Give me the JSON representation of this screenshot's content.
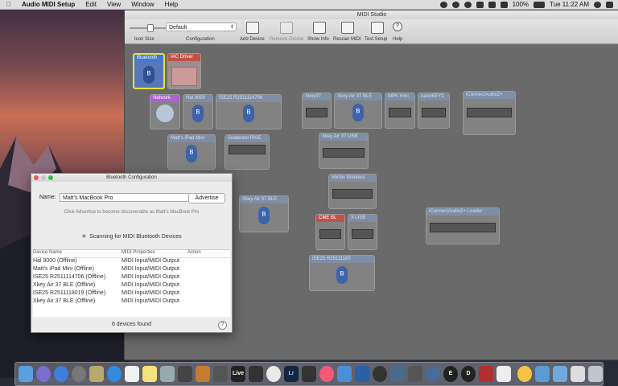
{
  "menubar": {
    "apple": "",
    "app_name": "Audio MIDI Setup",
    "menus": [
      "Edit",
      "View",
      "Window",
      "Help"
    ],
    "battery": "100%",
    "clock": "Tue 11:22 AM"
  },
  "studio": {
    "title": "MIDI Studio",
    "toolbar": {
      "icon_size_label": "Icon Size",
      "configuration_label": "Configuration",
      "configuration_value": "Default",
      "add_device": "Add Device",
      "remove_device": "Remove Device",
      "show_info": "Show Info",
      "rescan_midi": "Rescan MIDI",
      "test_setup": "Test Setup",
      "help": "Help",
      "help_glyph": "?"
    },
    "devices": {
      "bluetooth": "Bluetooth",
      "iac_driver": "IAC Driver",
      "network": "Network",
      "hal_9000": "Hal 9000",
      "ise25": "ISE25 R2511114706",
      "matts_ipad": "Matt's iPad Mini",
      "seaboard": "Seaboard RISE",
      "xkey37": "Xkey37",
      "xkey_air_37_ble_top": "Xkey Air 37 BLE",
      "mpk_mini": "MPK mini",
      "nano_q3": "nanoKEY2",
      "iconnect": "iConnectAudio2+",
      "xkey_air_37_usb": "Xkey Air 37 USB",
      "vortex": "Vortex Wireless",
      "xkey_air_37_ble": "Xkey Air 37 BLE",
      "cme_bl": "CME BL",
      "x_usb": "X-USB",
      "iconnect_loader": "iConnectAudio2+ Loader",
      "ise25_bottom": "ISE25 R25111180",
      "bt_glyph": "ᴮ"
    }
  },
  "bt_window": {
    "title": "Bluetooth Configuration",
    "name_label": "Name:",
    "name_value": "Matt's MacBook Pro",
    "advertise": "Advertise",
    "hint": "Click Advertise to become discoverable as Matt's MacBook Pro",
    "scanning": "Scanning for MIDI Bluetooth Devices",
    "columns": [
      "Device Name",
      "MIDI Properties",
      "Action"
    ],
    "rows": [
      [
        "Hal 9000 (Offline)",
        "MIDI Input/MIDI Output",
        ""
      ],
      [
        "Matt's iPad Mini (Offline)",
        "MIDI Input/MIDI Output",
        ""
      ],
      [
        "ISE25 R2511114706 (Offline)",
        "MIDI Input/MIDI Output",
        ""
      ],
      [
        "Xkey Air 37 BLE (Offline)",
        "MIDI Input/MIDI Output",
        ""
      ],
      [
        "ISE25 R2511118019 (Offline)",
        "MIDI Input/MIDI Output",
        ""
      ],
      [
        "Xkey Air 37 BLE (Offline)",
        "MIDI Input/MIDI Output",
        ""
      ]
    ],
    "count": "6 devices found",
    "help": "?"
  },
  "dock": {
    "live_label": "Live",
    "lr_label": "Lr",
    "e_label": "E",
    "d_label": "D"
  }
}
